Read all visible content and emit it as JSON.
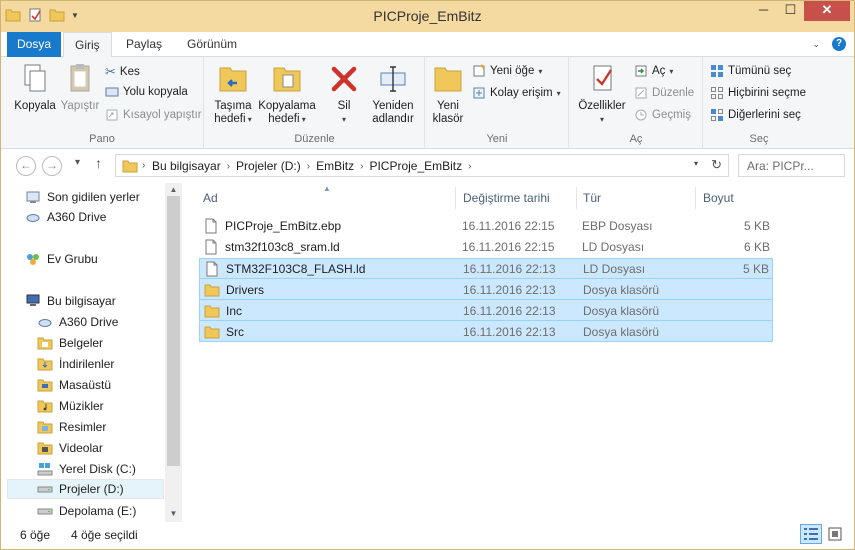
{
  "window": {
    "title": "PICProje_EmBitz",
    "minimize": "─",
    "maximize": "☐",
    "close": "✕"
  },
  "tabs": {
    "file": "Dosya",
    "home": "Giriş",
    "share": "Paylaş",
    "view": "Görünüm"
  },
  "ribbon": {
    "clipboard": {
      "label": "Pano",
      "copy": "Kopyala",
      "paste": "Yapıştır",
      "cut": "Kes",
      "copy_path": "Yolu kopyala",
      "paste_shortcut": "Kısayol yapıştır"
    },
    "organize": {
      "label": "Düzenle",
      "move_to_1": "Taşıma",
      "move_to_2": "hedefi",
      "copy_to_1": "Kopyalama",
      "copy_to_2": "hedefi",
      "delete": "Sil",
      "rename_1": "Yeniden",
      "rename_2": "adlandır"
    },
    "new": {
      "label": "Yeni",
      "new_folder_1": "Yeni",
      "new_folder_2": "klasör",
      "new_item": "Yeni öğe",
      "easy_access": "Kolay erişim"
    },
    "open": {
      "label": "Aç",
      "properties": "Özellikler",
      "open": "Aç",
      "edit": "Düzenle",
      "history": "Geçmiş"
    },
    "select": {
      "label": "Seç",
      "select_all": "Tümünü seç",
      "select_none": "Hiçbirini seçme",
      "invert": "Diğerlerini seç"
    }
  },
  "address": {
    "crumbs": [
      "Bu bilgisayar",
      "Projeler (D:)",
      "EmBitz",
      "PICProje_EmBitz"
    ],
    "search_placeholder": "Ara: PICPr..."
  },
  "nav": {
    "items": [
      {
        "label": "Son gidilen yerler",
        "icon": "recent-places-icon"
      },
      {
        "label": "A360 Drive",
        "icon": "cloud-drive-icon"
      },
      {
        "label": "Ev Grubu",
        "icon": "homegroup-icon"
      },
      {
        "label": "Bu bilgisayar",
        "icon": "computer-icon"
      },
      {
        "label": "A360 Drive",
        "icon": "cloud-drive-icon"
      },
      {
        "label": "Belgeler",
        "icon": "documents-folder-icon"
      },
      {
        "label": "İndirilenler",
        "icon": "downloads-folder-icon"
      },
      {
        "label": "Masaüstü",
        "icon": "desktop-folder-icon"
      },
      {
        "label": "Müzikler",
        "icon": "music-folder-icon"
      },
      {
        "label": "Resimler",
        "icon": "pictures-folder-icon"
      },
      {
        "label": "Videolar",
        "icon": "videos-folder-icon"
      },
      {
        "label": "Yerel Disk (C:)",
        "icon": "system-drive-icon"
      },
      {
        "label": "Projeler (D:)",
        "icon": "drive-icon"
      },
      {
        "label": "Depolama (E:)",
        "icon": "drive-icon"
      }
    ]
  },
  "files": {
    "headers": {
      "name": "Ad",
      "date": "Değiştirme tarihi",
      "type": "Tür",
      "size": "Boyut"
    },
    "rows": [
      {
        "name": "PICProje_EmBitz.ebp",
        "date": "16.11.2016 22:15",
        "type": "EBP Dosyası",
        "size": "5 KB",
        "kind": "file",
        "selected": false
      },
      {
        "name": "stm32f103c8_sram.ld",
        "date": "16.11.2016 22:15",
        "type": "LD Dosyası",
        "size": "6 KB",
        "kind": "file",
        "selected": false
      },
      {
        "name": "STM32F103C8_FLASH.ld",
        "date": "16.11.2016 22:13",
        "type": "LD Dosyası",
        "size": "5 KB",
        "kind": "file",
        "selected": true
      },
      {
        "name": "Drivers",
        "date": "16.11.2016 22:13",
        "type": "Dosya klasörü",
        "size": "",
        "kind": "folder",
        "selected": true
      },
      {
        "name": "Inc",
        "date": "16.11.2016 22:13",
        "type": "Dosya klasörü",
        "size": "",
        "kind": "folder",
        "selected": true
      },
      {
        "name": "Src",
        "date": "16.11.2016 22:13",
        "type": "Dosya klasörü",
        "size": "",
        "kind": "folder",
        "selected": true
      }
    ]
  },
  "status": {
    "count": "6 öğe",
    "selected": "4 öğe seçildi"
  },
  "colors": {
    "accent": "#1979ca",
    "selection": "#cce8ff",
    "selection_border": "#99d1ff",
    "frame": "#f4d9a0",
    "close": "#c7504a",
    "folder": "#f0c85a"
  }
}
